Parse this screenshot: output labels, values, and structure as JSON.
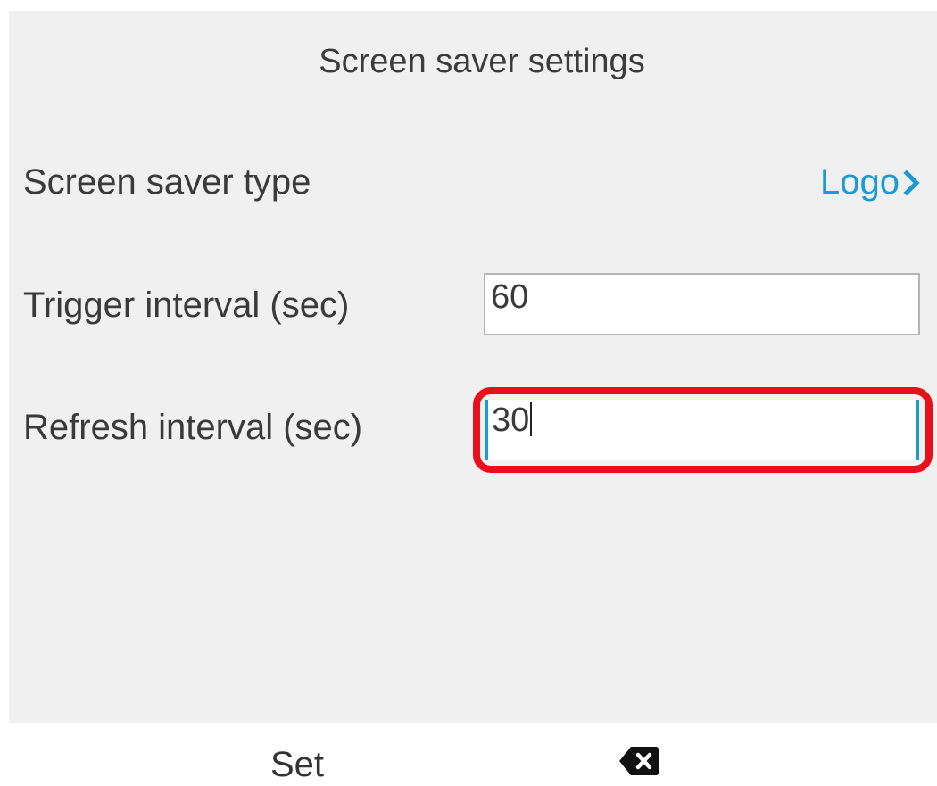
{
  "header": {
    "title": "Screen saver settings"
  },
  "settings": {
    "screen_saver_type": {
      "label": "Screen saver type",
      "value": "Logo",
      "icon": "chevron-right-icon"
    },
    "trigger_interval": {
      "label": "Trigger interval (sec)",
      "value": "60"
    },
    "refresh_interval": {
      "label": "Refresh interval (sec)",
      "value": "30"
    }
  },
  "softkeys": {
    "set_label": "Set",
    "backspace_icon": "backspace-icon"
  },
  "colors": {
    "accent": "#1c9ad6",
    "highlight": "#e8101a",
    "background": "#f0f0f0"
  }
}
